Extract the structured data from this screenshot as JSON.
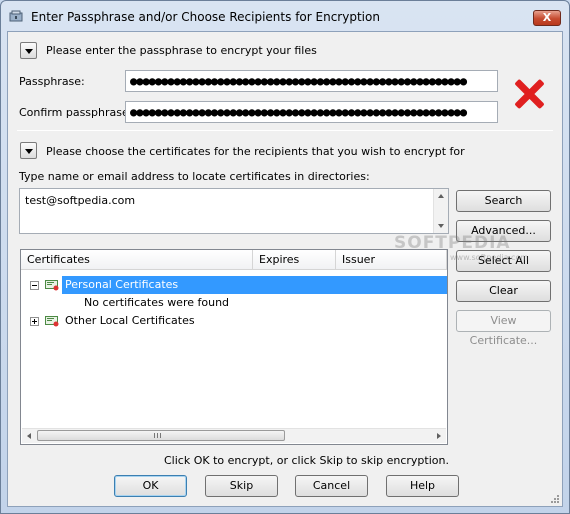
{
  "window": {
    "title": "Enter Passphrase and/or Choose Recipients for Encryption",
    "close_label": "X"
  },
  "passphrase_section": {
    "heading": "Please enter the passphrase to encrypt your files",
    "passphrase_label": "Passphrase:",
    "passphrase_value": "●●●●●●●●●●●●●●●●●●●●●●●●●●●●●●●●●●●●●●●●●●●●●●●●●●●●●●",
    "confirm_label": "Confirm passphrase:",
    "confirm_value": "●●●●●●●●●●●●●●●●●●●●●●●●●●●●●●●●●●●●●●●●●●●●●●●●●●●●●●",
    "mismatch_icon": "red-x-icon"
  },
  "recipients_section": {
    "heading": "Please choose the certificates for the recipients that you wish to encrypt for",
    "search_prompt": "Type name or email address to locate certificates in directories:",
    "search_value": "test@softpedia.com"
  },
  "certificates_table": {
    "columns": [
      "Certificates",
      "Expires",
      "Issuer"
    ],
    "nodes": [
      {
        "label": "Personal Certificates",
        "expanded": true,
        "selected": true
      },
      {
        "label": "No certificates were found",
        "child": true
      },
      {
        "label": "Other Local Certificates",
        "expanded": false,
        "selected": false
      }
    ]
  },
  "side_buttons": {
    "search": "Search",
    "advanced": "Advanced...",
    "select_all": "Select All",
    "clear": "Clear",
    "view_certificate": "View Certificate..."
  },
  "footer": {
    "hint": "Click OK to encrypt, or click Skip to skip encryption.",
    "ok": "OK",
    "skip": "Skip",
    "cancel": "Cancel",
    "help": "Help"
  },
  "watermark": {
    "brand": "SOFTPEDIA",
    "url": "www.softpedia.com"
  },
  "colors": {
    "selection": "#3399ff",
    "mismatch": "#e02020"
  }
}
